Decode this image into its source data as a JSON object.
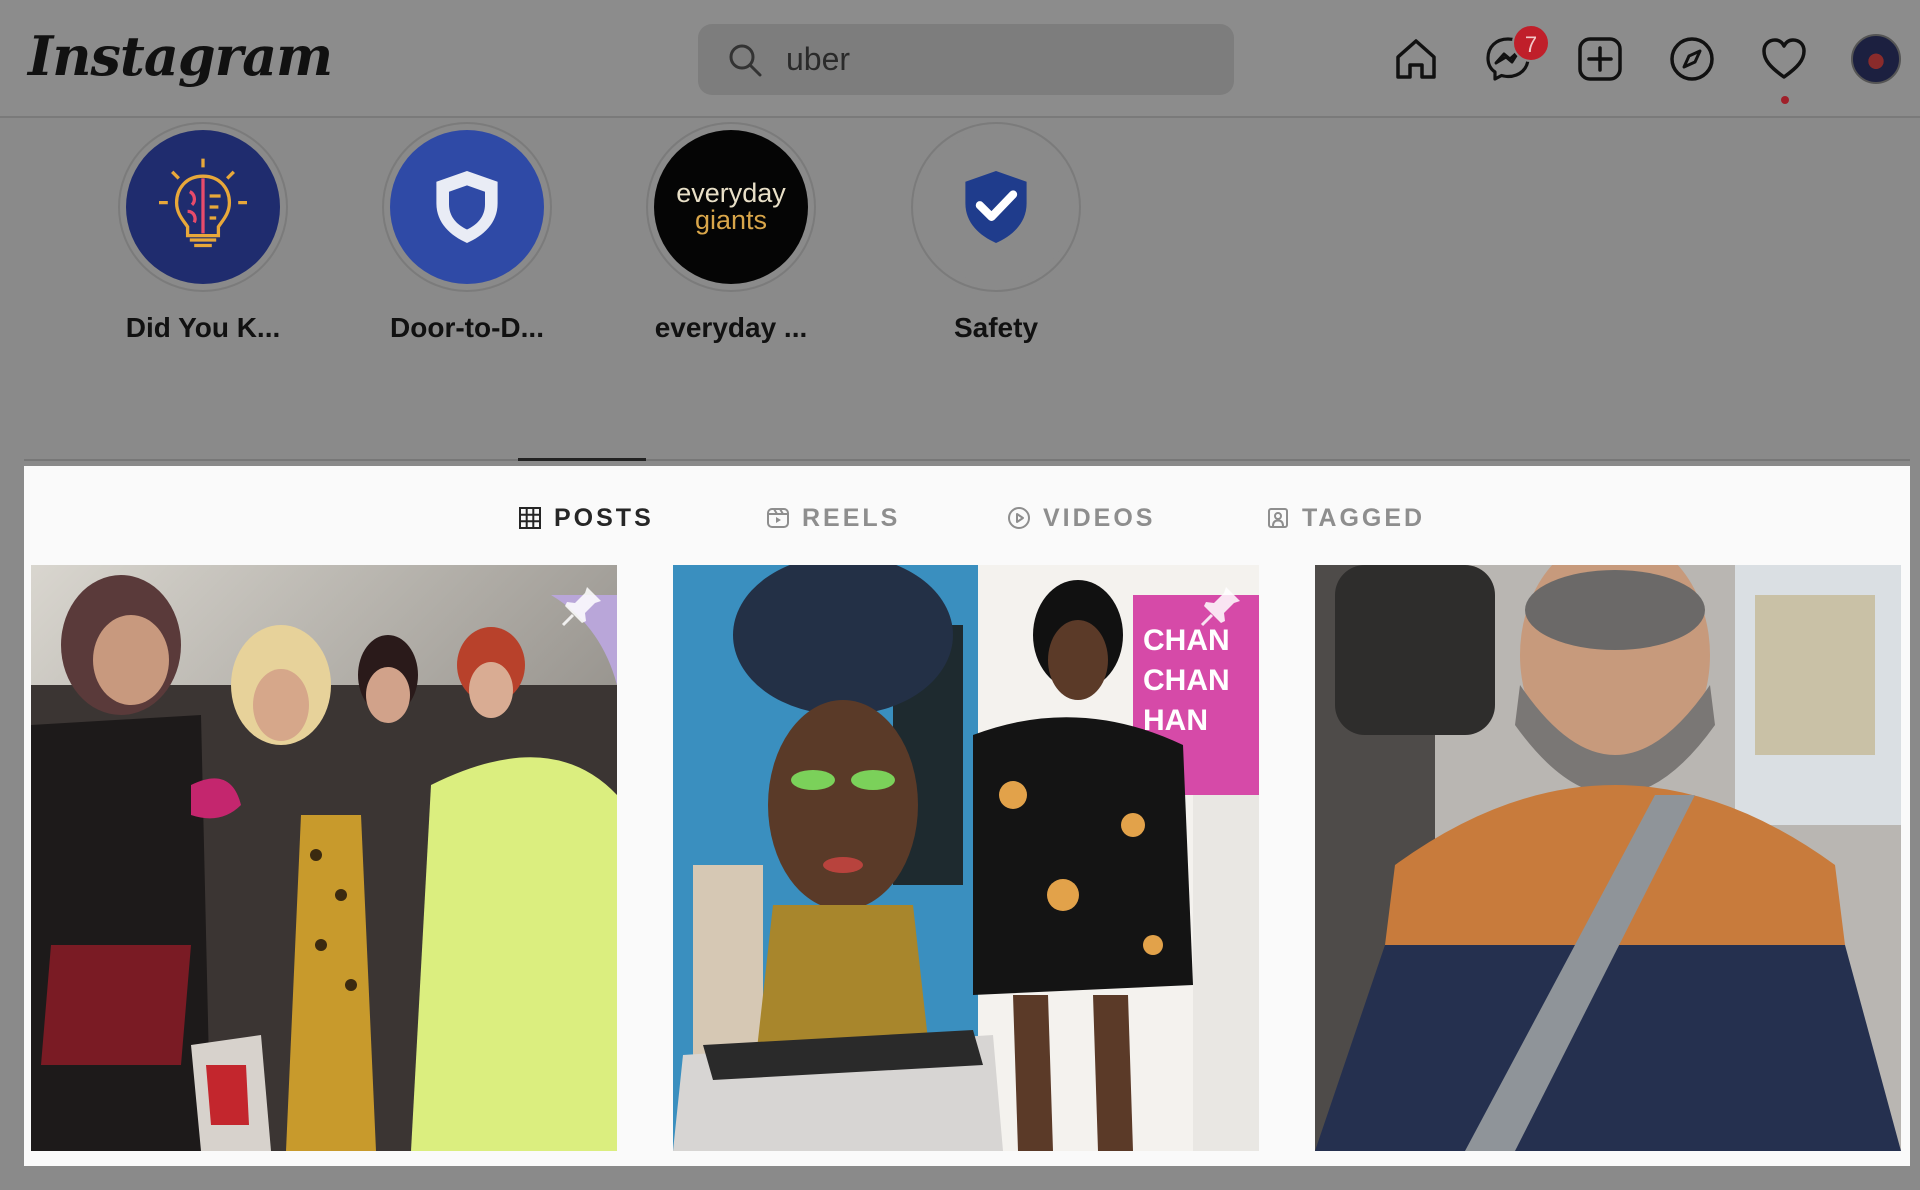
{
  "header": {
    "logo_text": "Instagram",
    "search": {
      "value": "uber",
      "placeholder": "Search"
    },
    "messages_badge": "7",
    "icons": [
      "home-icon",
      "messenger-icon",
      "new-post-icon",
      "explore-icon",
      "heart-icon",
      "avatar"
    ]
  },
  "highlights": [
    {
      "label": "Did You K...",
      "icon": "lightbulb-brain-icon"
    },
    {
      "label": "Door-to-D...",
      "icon": "shield-icon"
    },
    {
      "label": "everyday ...",
      "icon": "everyday-giants-logo",
      "logo_line1": "everyday",
      "logo_line2": "giants"
    },
    {
      "label": "Safety",
      "icon": "shield-check-icon"
    }
  ],
  "tabs": [
    {
      "label": "POSTS",
      "icon": "grid-icon",
      "active": true
    },
    {
      "label": "REELS",
      "icon": "reels-icon",
      "active": false
    },
    {
      "label": "VIDEOS",
      "icon": "play-circle-icon",
      "active": false
    },
    {
      "label": "TAGGED",
      "icon": "tagged-icon",
      "active": false
    }
  ],
  "posts": [
    {
      "pinned": true
    },
    {
      "pinned": true
    },
    {
      "pinned": false
    }
  ],
  "colors": {
    "overlay_bg": "#8a8a8a",
    "panel_bg": "#fafafa",
    "badge_red": "#c01f2a",
    "active_tab_text": "#262626",
    "inactive_tab_text": "#8e8e8e"
  }
}
